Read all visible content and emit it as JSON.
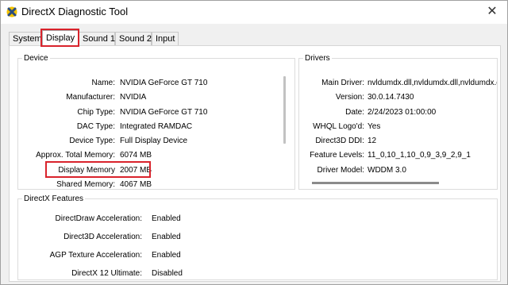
{
  "window": {
    "title": "DirectX Diagnostic Tool",
    "close_glyph": "✕"
  },
  "tabs": [
    {
      "label": "System",
      "active": false
    },
    {
      "label": "Display",
      "active": true
    },
    {
      "label": "Sound 1",
      "active": false
    },
    {
      "label": "Sound 2",
      "active": false
    },
    {
      "label": "Input",
      "active": false
    }
  ],
  "device": {
    "title": "Device",
    "rows": [
      {
        "label": "Name:",
        "value": "NVIDIA GeForce GT 710"
      },
      {
        "label": "Manufacturer:",
        "value": "NVIDIA"
      },
      {
        "label": "Chip Type:",
        "value": "NVIDIA GeForce GT 710"
      },
      {
        "label": "DAC Type:",
        "value": "Integrated RAMDAC"
      },
      {
        "label": "Device Type:",
        "value": "Full Display Device"
      },
      {
        "label": "Approx. Total Memory:",
        "value": "6074 MB"
      },
      {
        "label": "Display Memory",
        "value": "2007 MB"
      },
      {
        "label": "Shared Memory:",
        "value": "4067 MB"
      }
    ]
  },
  "drivers": {
    "title": "Drivers",
    "rows": [
      {
        "label": "Main Driver:",
        "value": "nvldumdx.dll,nvldumdx.dll,nvldumdx.d"
      },
      {
        "label": "Version:",
        "value": "30.0.14.7430"
      },
      {
        "label": "Date:",
        "value": "2/24/2023 01:00:00"
      },
      {
        "label": "WHQL Logo'd:",
        "value": "Yes"
      },
      {
        "label": "Direct3D DDI:",
        "value": "12"
      },
      {
        "label": "Feature Levels:",
        "value": "11_0,10_1,10_0,9_3,9_2,9_1"
      },
      {
        "label": "Driver Model:",
        "value": "WDDM 3.0"
      }
    ]
  },
  "features": {
    "title": "DirectX Features",
    "rows": [
      {
        "label": "DirectDraw Acceleration:",
        "value": "Enabled"
      },
      {
        "label": "Direct3D Acceleration:",
        "value": "Enabled"
      },
      {
        "label": "AGP Texture Acceleration:",
        "value": "Enabled"
      },
      {
        "label": "DirectX 12 Ultimate:",
        "value": "Disabled"
      }
    ]
  },
  "colors": {
    "highlight": "#d9232c",
    "icon_x": "#2b4c7e",
    "icon_yellow": "#f2c200"
  }
}
